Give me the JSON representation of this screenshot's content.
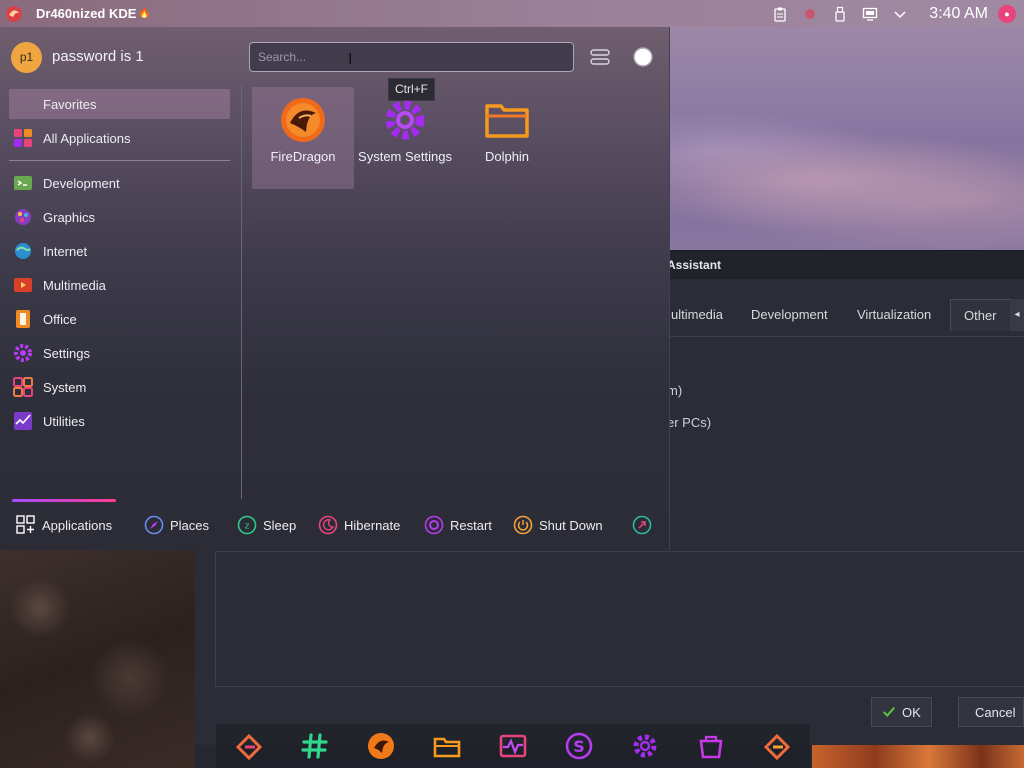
{
  "topbar": {
    "title": "Dr460nized KDE",
    "clock": "3:40 AM"
  },
  "launcher": {
    "user": {
      "avatar_initials": "p1",
      "name": "password is 1"
    },
    "search": {
      "placeholder": "Search...",
      "shortcut_tooltip": "Ctrl+F"
    },
    "categories": [
      {
        "label": "Favorites",
        "icon": "star-icon",
        "active": true
      },
      {
        "label": "All Applications",
        "icon": "grid-icon"
      },
      {
        "label": "Development",
        "icon": "development-icon"
      },
      {
        "label": "Graphics",
        "icon": "graphics-icon"
      },
      {
        "label": "Internet",
        "icon": "internet-icon"
      },
      {
        "label": "Multimedia",
        "icon": "multimedia-icon"
      },
      {
        "label": "Office",
        "icon": "office-icon"
      },
      {
        "label": "Settings",
        "icon": "settings-icon"
      },
      {
        "label": "System",
        "icon": "system-icon"
      },
      {
        "label": "Utilities",
        "icon": "utilities-icon"
      }
    ],
    "favorites": [
      {
        "label": "FireDragon",
        "icon": "firedragon-icon",
        "selected": true
      },
      {
        "label": "System Settings",
        "icon": "system-settings-icon"
      },
      {
        "label": "Dolphin",
        "icon": "dolphin-folder-icon"
      }
    ],
    "footer": {
      "applications": "Applications",
      "places": "Places",
      "sleep": "Sleep",
      "hibernate": "Hibernate",
      "restart": "Restart",
      "shutdown": "Shut Down"
    }
  },
  "dialog": {
    "title": "Assistant",
    "tabs": [
      "ultimedia",
      "Development",
      "Virtualization",
      "Other"
    ],
    "active_tab": "Other",
    "lines": [
      "m)",
      "er PCs)"
    ],
    "ok": "OK",
    "cancel": "Cancel"
  },
  "dock": {
    "items": [
      "garuda-icon",
      "hashtag-icon",
      "firedragon-icon",
      "folder-icon",
      "system-monitor-icon",
      "octopi-icon",
      "settings-icon",
      "software-store-icon",
      "garuda-icon"
    ]
  },
  "colors": {
    "accent_pink": "#e8447c",
    "accent_orange": "#f08a24",
    "accent_purple": "#a32cf0"
  }
}
